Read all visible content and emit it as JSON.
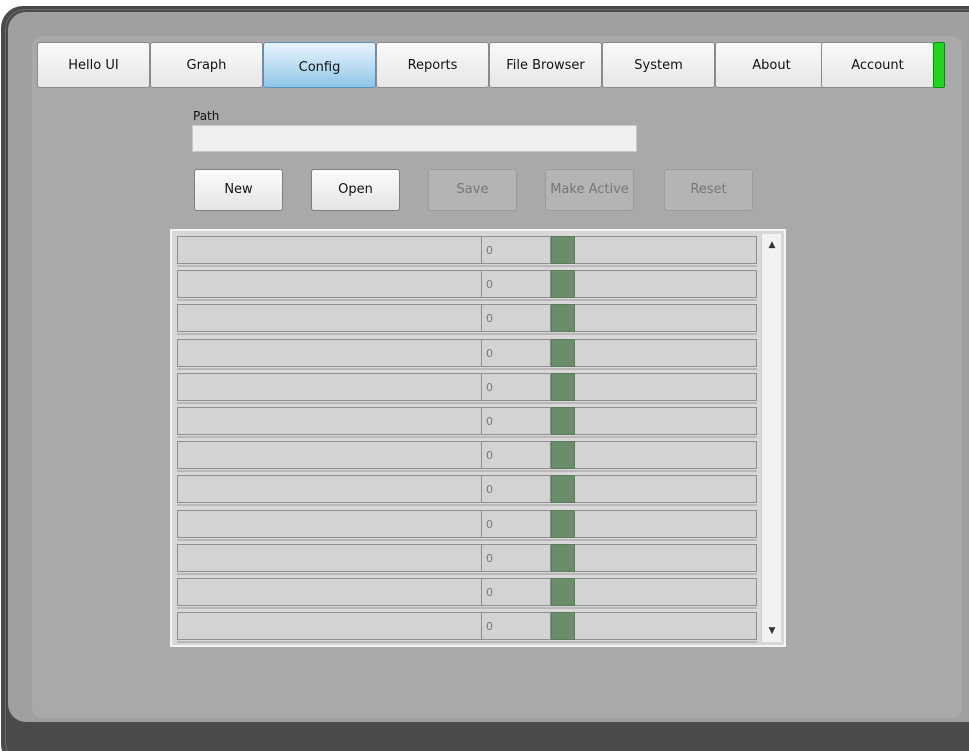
{
  "tabs": [
    {
      "label": "Hello UI",
      "active": false
    },
    {
      "label": "Graph",
      "active": false
    },
    {
      "label": "Config",
      "active": true
    },
    {
      "label": "Reports",
      "active": false
    },
    {
      "label": "File Browser",
      "active": false
    },
    {
      "label": "System",
      "active": false
    },
    {
      "label": "About",
      "active": false
    },
    {
      "label": "Account",
      "active": false
    }
  ],
  "status_indicator_color": "#1fd51f",
  "config": {
    "path_label": "Path",
    "path_value": "",
    "buttons": {
      "new": "New",
      "open": "Open",
      "save": "Save",
      "make_active": "Make Active",
      "reset": "Reset"
    },
    "rows": [
      {
        "name": "",
        "value": "0",
        "swatch_color": "#6a8e6a"
      },
      {
        "name": "",
        "value": "0",
        "swatch_color": "#6a8e6a"
      },
      {
        "name": "",
        "value": "0",
        "swatch_color": "#6a8e6a"
      },
      {
        "name": "",
        "value": "0",
        "swatch_color": "#6a8e6a"
      },
      {
        "name": "",
        "value": "0",
        "swatch_color": "#6a8e6a"
      },
      {
        "name": "",
        "value": "0",
        "swatch_color": "#6a8e6a"
      },
      {
        "name": "",
        "value": "0",
        "swatch_color": "#6a8e6a"
      },
      {
        "name": "",
        "value": "0",
        "swatch_color": "#6a8e6a"
      },
      {
        "name": "",
        "value": "0",
        "swatch_color": "#6a8e6a"
      },
      {
        "name": "",
        "value": "0",
        "swatch_color": "#6a8e6a"
      },
      {
        "name": "",
        "value": "0",
        "swatch_color": "#6a8e6a"
      },
      {
        "name": "",
        "value": "0",
        "swatch_color": "#6a8e6a"
      }
    ],
    "scroll_up_icon": "triangle-up-icon",
    "scroll_down_icon": "triangle-down-icon"
  }
}
